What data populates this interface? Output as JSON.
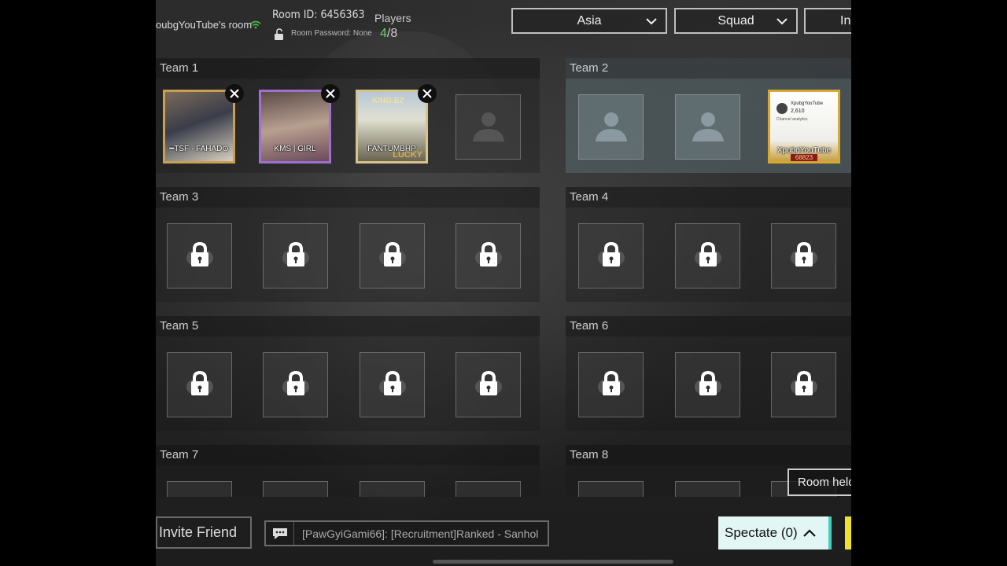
{
  "room": {
    "name": "oubgYouTube's room",
    "id_label": "Room ID: 6456363",
    "password_label": "Room Password: None",
    "players_label": "Players",
    "players_current": "4",
    "players_total": "/8"
  },
  "dropdowns": {
    "region": "Asia",
    "mode": "Squad",
    "invite_partial": "In"
  },
  "teams": [
    {
      "label": "Team 1",
      "players": [
        "━TSF · FAHAD⊙",
        "KMS | GIRL",
        "FANTUMBHP"
      ]
    },
    {
      "label": "Team 2",
      "players": [
        "XpubgYouTube"
      ],
      "player_badge": "68823",
      "card_texts": {
        "name": "XpubgYouTube",
        "count": "2,610",
        "line": "Channel analytics"
      }
    },
    {
      "label": "Team 3"
    },
    {
      "label": "Team 4"
    },
    {
      "label": "Team 5"
    },
    {
      "label": "Team 6"
    },
    {
      "label": "Team 7"
    },
    {
      "label": "Team 8"
    }
  ],
  "card_overlay": {
    "team1_slot3_logo": "KING.EZ",
    "team1_slot3_stamp": "LUCKY"
  },
  "footer": {
    "invite_friend": "Invite Friend",
    "chat_message": "[PawGyiGami66]: [Recruitment]Ranked - Sanhol",
    "spectate": "Spectate (0)",
    "room_held": "Room held"
  },
  "colors": {
    "players_current": "#6ecf6e",
    "spectate_bg": "#e2f7f4",
    "spectate_accent": "#3fd0c0",
    "yellow_button": "#f0e22a",
    "gold_frame": "#c8a050"
  }
}
